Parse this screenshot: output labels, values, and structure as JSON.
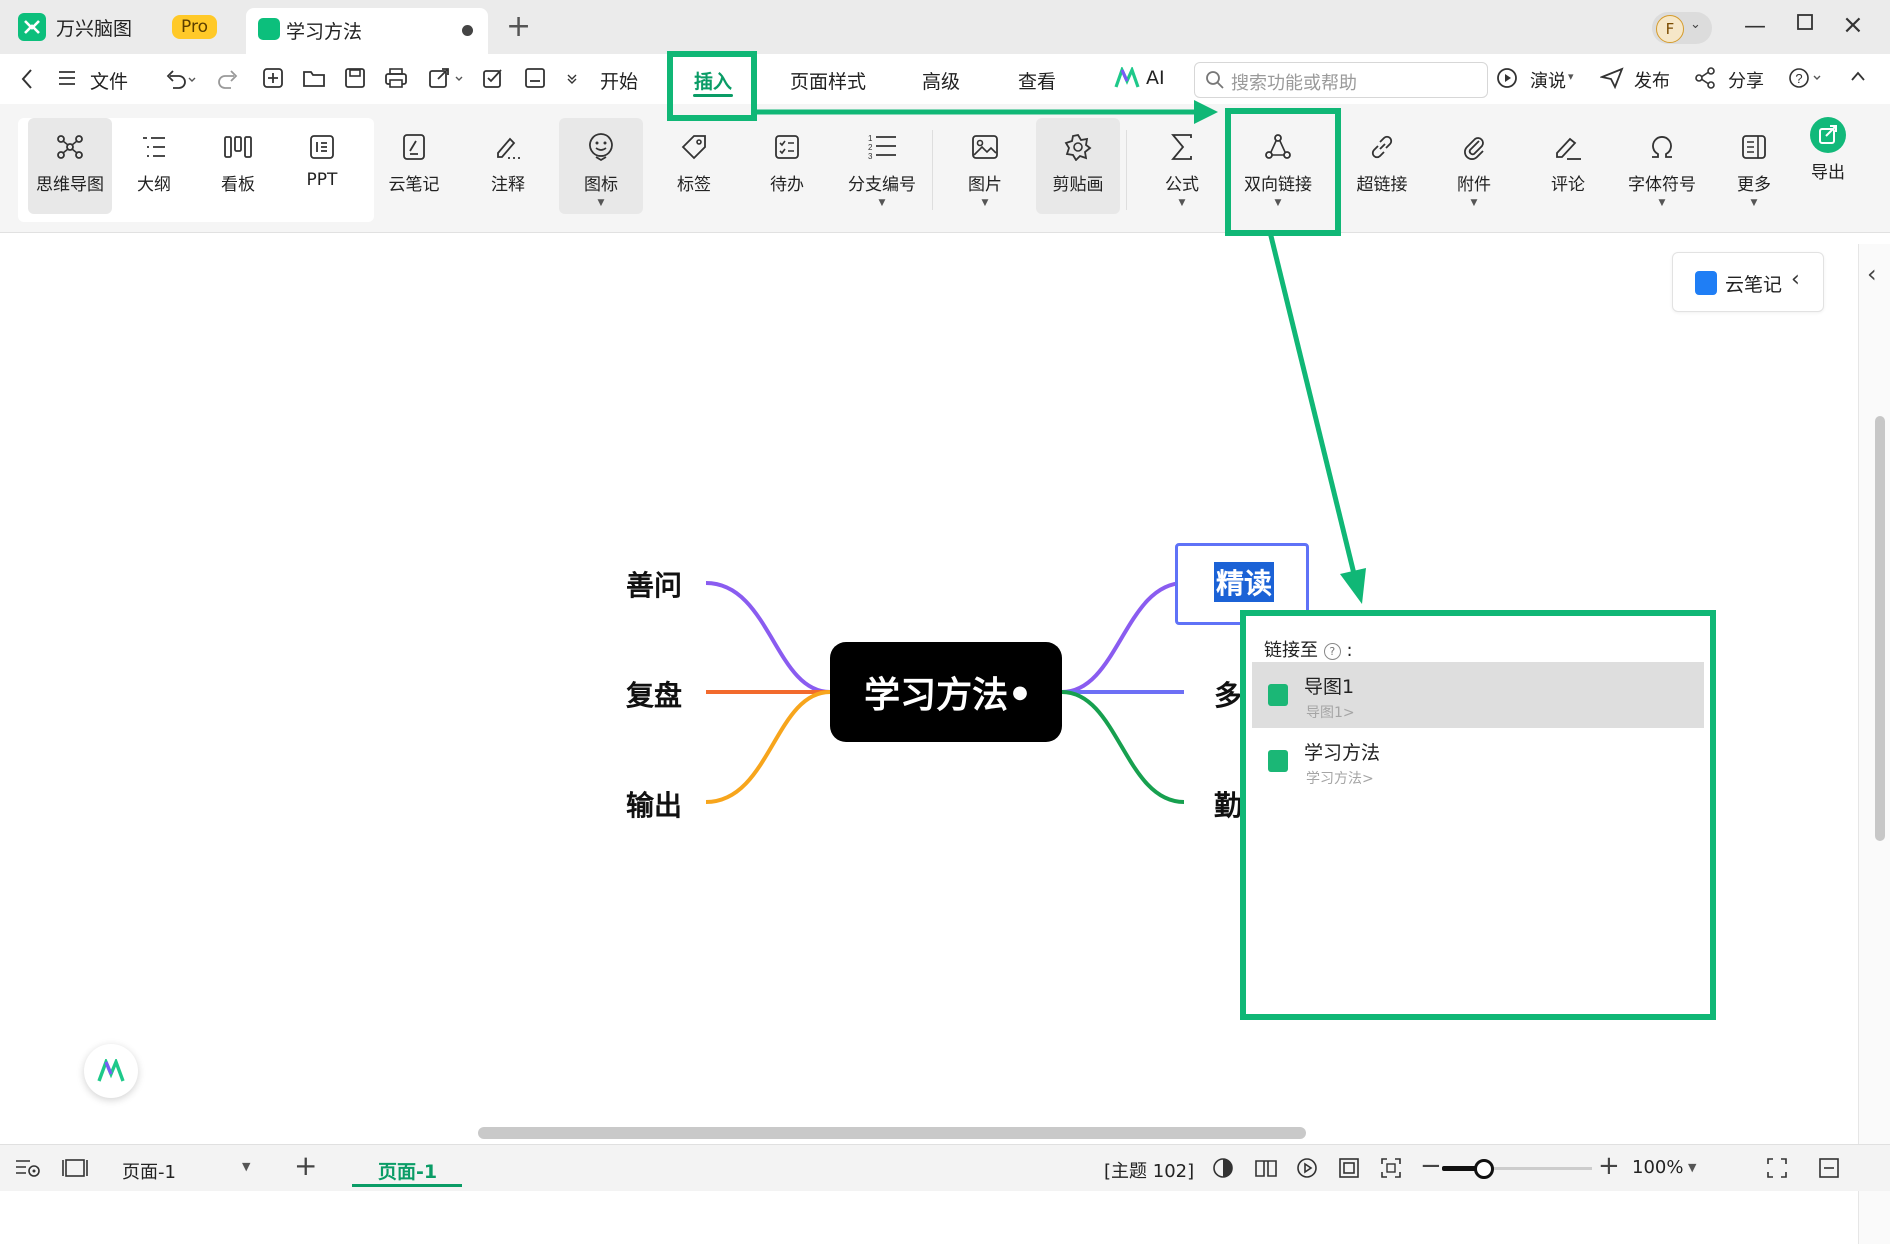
{
  "app": {
    "name": "万兴脑图",
    "badge": "Pro"
  },
  "tab": {
    "title": "学习方法"
  },
  "user": {
    "initial": "F"
  },
  "menu": {
    "file": "文件",
    "start": "开始",
    "insert": "插入",
    "page_style": "页面样式",
    "advanced": "高级",
    "view": "查看",
    "ai": "AI",
    "present": "演说",
    "publish": "发布",
    "share": "分享"
  },
  "search": {
    "placeholder": "搜索功能或帮助"
  },
  "ribbon": {
    "mindmap": "思维导图",
    "outline": "大纲",
    "board": "看板",
    "ppt": "PPT",
    "cloud_note": "云笔记",
    "annotation": "注释",
    "icon": "图标",
    "tag": "标签",
    "todo": "待办",
    "numbering": "分支编号",
    "image": "图片",
    "clipart": "剪贴画",
    "formula": "公式",
    "bilink": "双向链接",
    "hyperlink": "超链接",
    "attachment": "附件",
    "comment": "评论",
    "symbol": "字体符号",
    "more": "更多",
    "export": "导出"
  },
  "cloud_panel": {
    "label": "云笔记"
  },
  "mindmap": {
    "root": "学习方法",
    "left": [
      "善问",
      "复盘",
      "输出"
    ],
    "right_selected": "精读",
    "right_partial": [
      "多",
      "勤"
    ]
  },
  "link_popup": {
    "title": "链接至",
    "items": [
      {
        "name": "导图1",
        "path": "导图1>"
      },
      {
        "name": "学习方法",
        "path": "学习方法>"
      }
    ]
  },
  "status": {
    "page_select": "页面-1",
    "page_tab": "页面-1",
    "topic_count": "[主题 102]",
    "zoom": "100%"
  },
  "colors": {
    "accent": "#0a9c66",
    "highlight": "#10b776",
    "branch_purple": "#8a5cf0",
    "branch_orange": "#f26a2d",
    "branch_yellow": "#f7a51c",
    "branch_blue": "#6d6ff5",
    "branch_green": "#17a04f"
  }
}
